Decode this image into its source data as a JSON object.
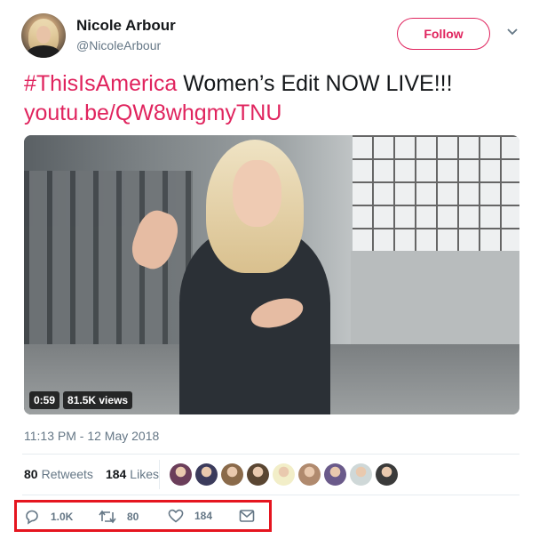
{
  "user": {
    "name": "Nicole Arbour",
    "handle": "@NicoleArbour",
    "follow_label": "Follow"
  },
  "tweet": {
    "hashtag": "#ThisIsAmerica",
    "text": " Women’s Edit NOW LIVE!!!",
    "link": "youtu.be/QW8whgmyTNU",
    "timestamp": "11:13 PM - 12 May 2018"
  },
  "video": {
    "duration": "0:59",
    "views": "81.5K views"
  },
  "stats": {
    "retweets_count": "80",
    "retweets_label": "Retweets",
    "likes_count": "184",
    "likes_label": "Likes"
  },
  "likers": [
    {
      "color": "#6b3e5a"
    },
    {
      "color": "#3b3b5c"
    },
    {
      "color": "#8a6a4a"
    },
    {
      "color": "#5a4632"
    },
    {
      "color": "#f2eec8"
    },
    {
      "color": "#b08a6e"
    },
    {
      "color": "#6a5a8a"
    },
    {
      "color": "#cfd8d8"
    },
    {
      "color": "#3a3a3a"
    }
  ],
  "actions": {
    "reply_count": "1.0K",
    "retweet_count": "80",
    "like_count": "184"
  },
  "colors": {
    "accent": "#e0245e",
    "highlight_box": "#e5151f"
  }
}
